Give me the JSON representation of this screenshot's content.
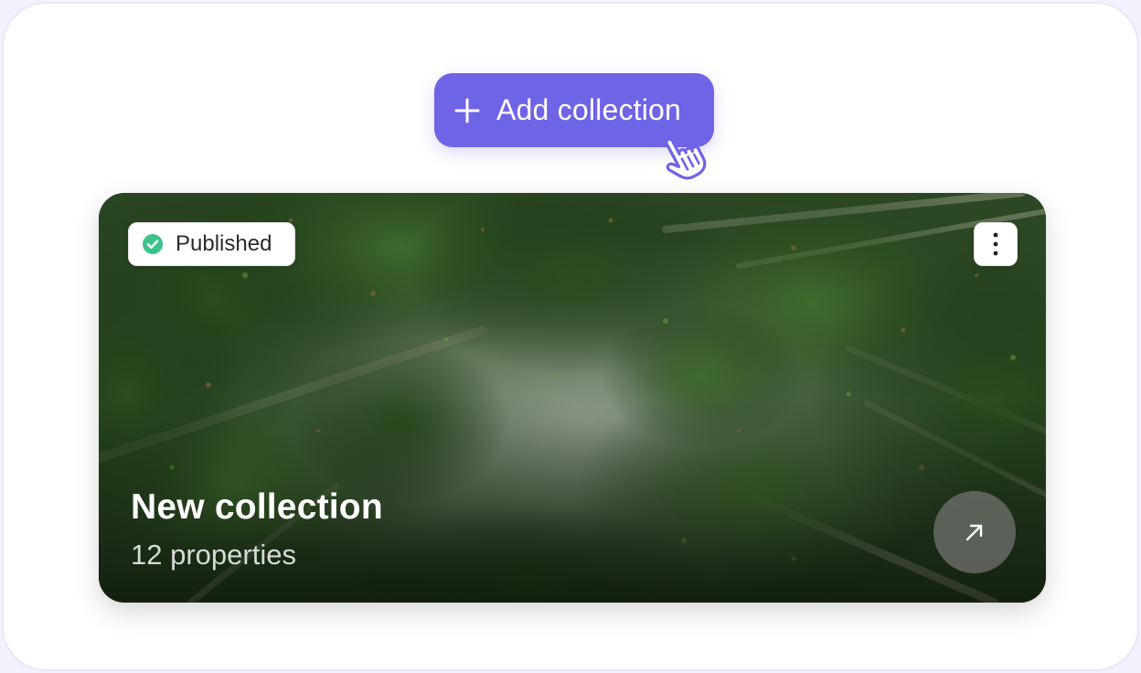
{
  "actions": {
    "add_collection_label": "Add collection",
    "add_icon": "plus-icon",
    "cursor_icon": "hand-pointer-icon"
  },
  "collection_card": {
    "status": "Published",
    "status_icon": "check-circle-icon",
    "status_color": "#3cc28a",
    "title": "New collection",
    "subtitle": "12 properties",
    "menu_icon": "kebab-icon",
    "open_icon": "arrow-up-right-icon",
    "image": "bamboo forest canopy"
  },
  "colors": {
    "accent": "#6f63e6",
    "frame_border": "#ebe6fb",
    "background": "#ffffff"
  }
}
